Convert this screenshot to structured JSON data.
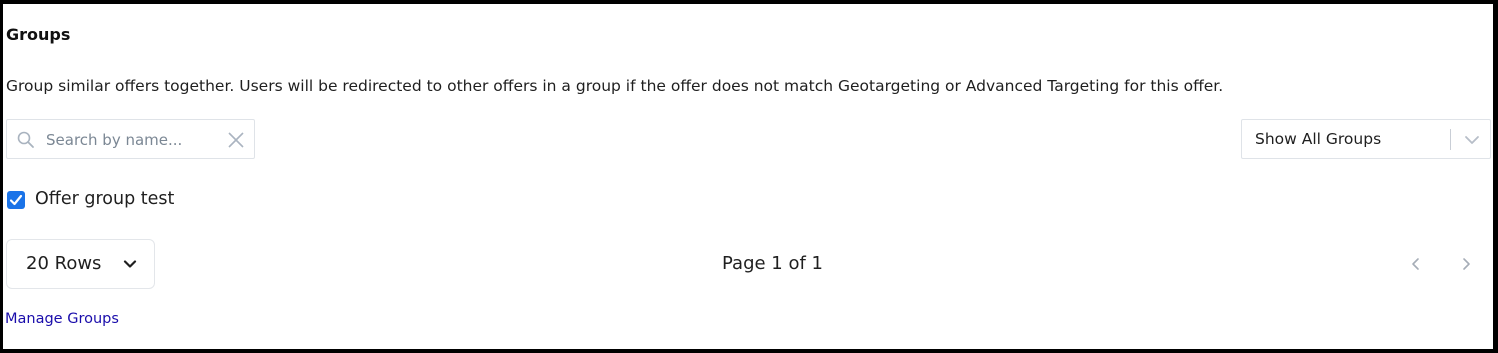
{
  "section": {
    "title": "Groups",
    "description": "Group similar offers together. Users will be redirected to other offers in a group if the offer does not match Geotargeting or Advanced Targeting for this offer."
  },
  "search": {
    "placeholder": "Search by name...",
    "value": "",
    "icon": "search-icon",
    "clear_icon": "close-icon"
  },
  "group_filter": {
    "selected": "Show All Groups",
    "icon": "chevron-down-icon"
  },
  "groups": [
    {
      "label": "Offer group test",
      "checked": true
    }
  ],
  "pagination": {
    "rows_label": "20 Rows",
    "page_text": "Page 1 of 1",
    "prev_icon": "chevron-left-icon",
    "next_icon": "chevron-right-icon"
  },
  "manage_link": "Manage Groups",
  "colors": {
    "checkbox": "#1a73e8",
    "link": "#1a0dab",
    "border": "#dfe3e8"
  }
}
